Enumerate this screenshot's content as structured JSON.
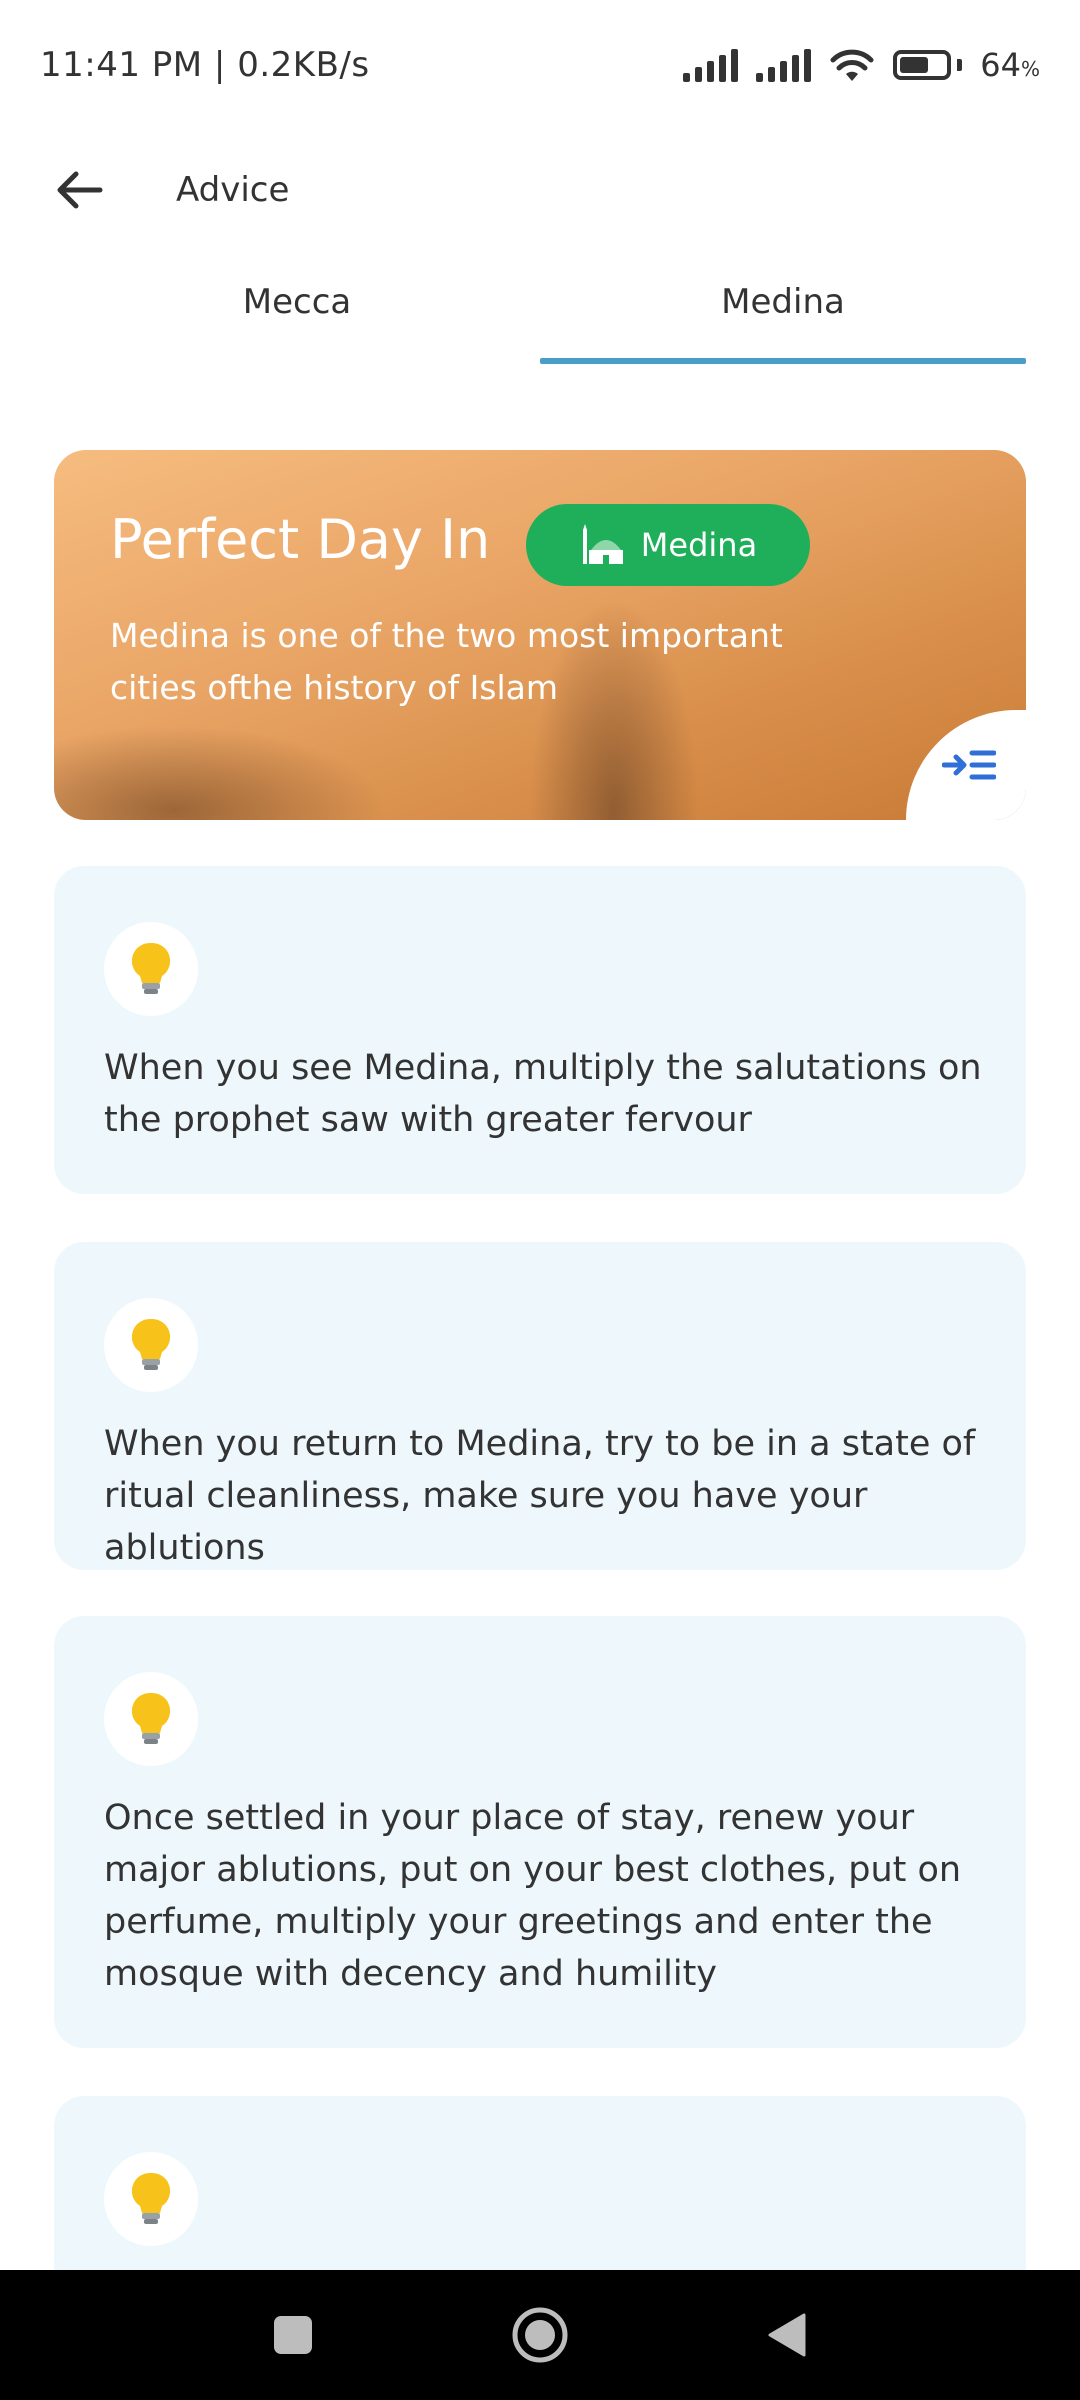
{
  "status_bar": {
    "time_speed": "11:41 PM | 0.2KB/s",
    "battery_percent": "64",
    "battery_unit": "%",
    "battery_level": 0.64
  },
  "header": {
    "title": "Advice",
    "back_icon": "arrow-left-icon"
  },
  "tabs": {
    "items": [
      {
        "label": "Mecca",
        "selected": false
      },
      {
        "label": "Medina",
        "selected": true
      }
    ],
    "indicator_color": "#4a9dc6"
  },
  "hero": {
    "title": "Perfect Day In",
    "chip_label": "Medina",
    "chip_icon": "mosque-icon",
    "chip_color": "#1faf5a",
    "description": "Medina is one of the two most important cities ofthe history of Islam",
    "corner_icon": "indent-list-icon"
  },
  "advice": {
    "icon": "lightbulb-icon",
    "items": [
      {
        "text": "When you see Medina, multiply the salutations on the prophet saw with greater fervour"
      },
      {
        "text": "When you return to Medina, try to be in a state of ritual cleanliness, make sure you have your ablutions"
      },
      {
        "text": "Once settled in your place of stay, renew your major ablutions, put on your best clothes, put on perfume, multiply your greetings and enter the mosque with decency and humility"
      },
      {
        "text": ""
      }
    ]
  },
  "nav_bar": {
    "buttons": [
      "recents-square-icon",
      "home-circle-icon",
      "back-triangle-icon"
    ]
  }
}
